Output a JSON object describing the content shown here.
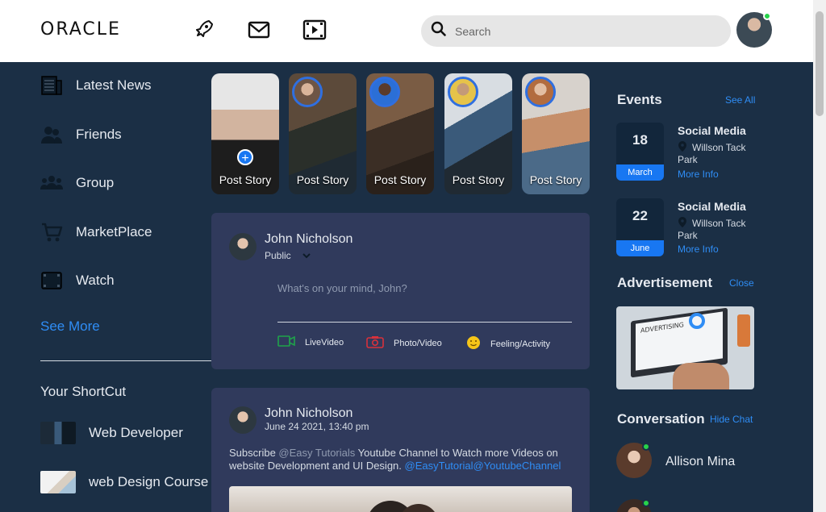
{
  "header": {
    "logo": "ORACLE",
    "search_placeholder": "Search"
  },
  "sidebar": {
    "items": [
      {
        "label": "Latest News",
        "icon": "newspaper-icon"
      },
      {
        "label": "Friends",
        "icon": "friends-icon"
      },
      {
        "label": "Group",
        "icon": "group-icon"
      },
      {
        "label": "MarketPlace",
        "icon": "cart-icon"
      },
      {
        "label": "Watch",
        "icon": "film-icon"
      }
    ],
    "see_more": "See More",
    "shortcut_title": "Your ShortCut",
    "shortcuts": [
      {
        "label": "Web Developer"
      },
      {
        "label": "web Design Course"
      }
    ]
  },
  "stories": [
    {
      "label": "Post Story"
    },
    {
      "label": "Post Story"
    },
    {
      "label": "Post Story"
    },
    {
      "label": "Post Story"
    },
    {
      "label": "Post Story"
    }
  ],
  "composer": {
    "name": "John Nicholson",
    "visibility": "Public",
    "placeholder": "What's on your mind, John?",
    "actions": [
      {
        "label": "LiveVideo",
        "icon": "video-camera-icon"
      },
      {
        "label": "Photo/Video",
        "icon": "photo-icon"
      },
      {
        "label": "Feeling/Activity",
        "icon": "emoji-icon"
      }
    ]
  },
  "post": {
    "name": "John Nicholson",
    "date": "June 24 2021, 13:40 pm",
    "text_prefix": "Subscribe ",
    "text_mention": "@Easy Tutorials",
    "text_body": " Youtube Channel to Watch more Videos on website Development and UI Design. ",
    "text_link": "@EasyTutorial@YoutubeChannel"
  },
  "events": {
    "title": "Events",
    "see_all": "See All",
    "items": [
      {
        "day": "18",
        "month": "March",
        "title": "Social Media",
        "place": "Willson Tack Park",
        "more": "More Info"
      },
      {
        "day": "22",
        "month": "June",
        "title": "Social Media",
        "place": "Willson Tack Park",
        "more": "More Info"
      }
    ]
  },
  "advertisement": {
    "title": "Advertisement",
    "close": "Close",
    "image_text": "ADVERTISING"
  },
  "conversation": {
    "title": "Conversation",
    "hide": "Hide Chat",
    "people": [
      {
        "name": "Allison Mina",
        "online": true
      }
    ]
  },
  "colors": {
    "background": "#1b2f45",
    "card": "#303a5c",
    "accent": "#1877f2",
    "link": "#2f8df5",
    "online": "#27d34a"
  }
}
